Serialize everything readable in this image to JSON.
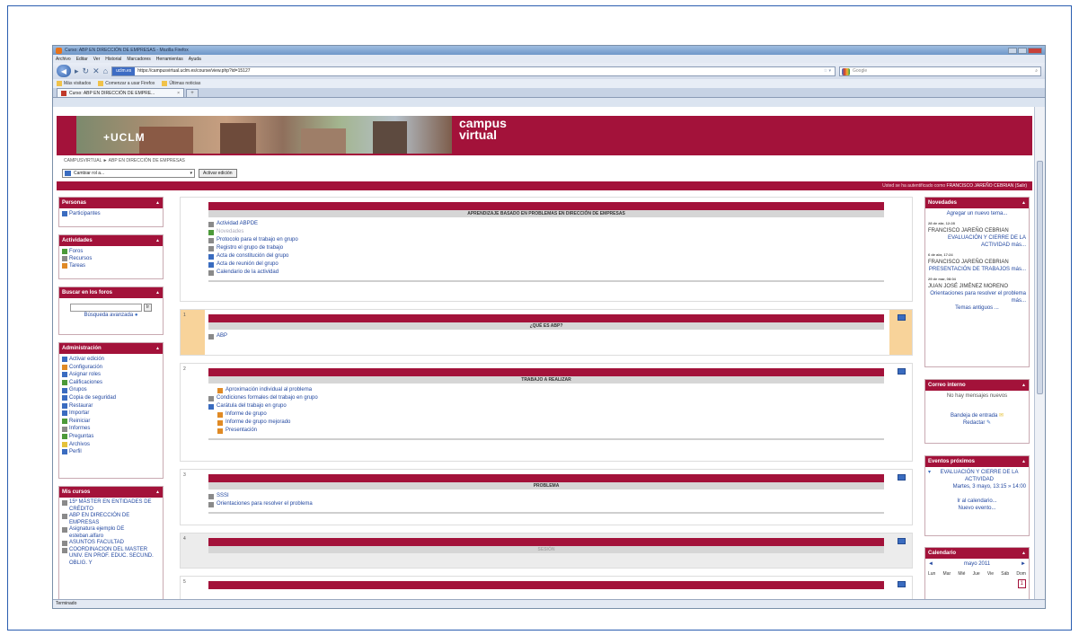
{
  "browser": {
    "title": "Curso: ABP EN DIRECCIÓN DE EMPRESAS - Mozilla Firefox",
    "menu": [
      "Archivo",
      "Editar",
      "Ver",
      "Historial",
      "Marcadores",
      "Herramientas",
      "Ayuda"
    ],
    "site_label": "uclm.es",
    "url": "https://campusvirtual.uclm.es/course/view.php?id=15127",
    "search_placeholder": "Google",
    "bookmarks": [
      "Más visitados",
      "Comenzar a usar Firefox",
      "Últimas noticias"
    ],
    "tab_title": "Curso: ABP EN DIRECCIÓN DE EMPRE...",
    "status": "Terminado"
  },
  "header": {
    "uclm": "+UCLM",
    "campus_line1": "campus",
    "campus_line2": "virtual",
    "breadcrumb": "CAMPUSVIRTUAL ► ABP EN DIRECCIÓN DE EMPRESAS",
    "role_select": "Cambiar rol a...",
    "edit_button": "Activar edición",
    "login_label": "Usted se ha autentificado como",
    "login_user": "FRANCISCO JAREÑO CEBRIAN",
    "logout": "(Salir)"
  },
  "left": {
    "personas": {
      "title": "Personas",
      "items": [
        "Participantes"
      ]
    },
    "actividades": {
      "title": "Actividades",
      "items": [
        "Foros",
        "Recursos",
        "Tareas"
      ]
    },
    "buscar": {
      "title": "Buscar en los foros",
      "go": "Ir",
      "advanced": "Búsqueda avanzada"
    },
    "admin": {
      "title": "Administración",
      "items": [
        "Activar edición",
        "Configuración",
        "Asignar roles",
        "Calificaciones",
        "Grupos",
        "Copia de seguridad",
        "Restaurar",
        "Importar",
        "Reiniciar",
        "Informes",
        "Preguntas",
        "Archivos",
        "Perfil"
      ]
    },
    "cursos": {
      "title": "Mis cursos",
      "items": [
        "15º MÁSTER EN ENTIDADES DE CRÉDITO",
        "ABP EN DIRECCIÓN DE EMPRESAS",
        "Asignatura ejemplo DE esteban.alfaro",
        "ASUNTOS FACULTAD",
        "COORDINACION DEL MASTER UNIV. EN PROF. EDUC. SECUND. OBLIG. Y"
      ]
    }
  },
  "sections": {
    "s0": {
      "title": "APRENDIZAJE BASADO EN PROBLEMAS EN DIRECCIÓN DE EMPRESAS",
      "items": [
        "Actividad ABPDE",
        "Novedades",
        "Protocolo para el trabajo en grupo",
        "Registro el grupo de trabajo",
        "Acta de constitución del grupo",
        "Acta de reunión del grupo",
        "Calendario de la actividad"
      ]
    },
    "s1": {
      "num": "1",
      "title": "¿QUÉ ES ABP?",
      "items": [
        "ABP"
      ]
    },
    "s2": {
      "num": "2",
      "title": "TRABAJO A REALIZAR",
      "items": [
        "Aproximación individual al problema",
        "Condiciones formales del trabajo en grupo",
        "Carátula del trabajo en grupo",
        "Informe de grupo",
        "Informe de grupo mejorado",
        "Presentación"
      ]
    },
    "s3": {
      "num": "3",
      "title": "PROBLEMA",
      "items": [
        "SSSI",
        "Orientaciones para resolver el problema"
      ]
    },
    "s4": {
      "num": "4",
      "title": "SESIÓN"
    },
    "s5": {
      "num": "5"
    }
  },
  "right": {
    "novedades": {
      "title": "Novedades",
      "add": "Agregar un nuevo tema...",
      "posts": [
        {
          "date": "28 de abr, 12:28",
          "author": "FRANCISCO JAREÑO CEBRIAN",
          "subject": "EVALUACIÓN Y CIERRE DE LA ACTIVIDAD más..."
        },
        {
          "date": "6 de abr, 17:24",
          "author": "FRANCISCO JAREÑO CEBRIAN",
          "subject": "PRESENTACIÓN DE TRABAJOS más..."
        },
        {
          "date": "29 de mar, 08:04",
          "author": "JUAN JOSÉ JIMÉNEZ MORENO",
          "subject": "Orientaciones para resolver el problema más..."
        }
      ],
      "older": "Temas antiguos ..."
    },
    "correo": {
      "title": "Correo interno",
      "empty": "No hay mensajes nuevos",
      "inbox": "Bandeja de entrada",
      "compose": "Redactar"
    },
    "eventos": {
      "title": "Eventos próximos",
      "event": "EVALUACIÓN Y CIERRE DE LA ACTIVIDAD",
      "when": "Martes, 3 mayo, 13:15 » 14:00",
      "goto": "Ir al calendario...",
      "new": "Nuevo evento..."
    },
    "calendario": {
      "title": "Calendario",
      "month": "mayo 2011",
      "days": [
        "Lun",
        "Mar",
        "Mié",
        "Jue",
        "Vie",
        "Sáb",
        "Dom"
      ],
      "today": "1"
    }
  }
}
